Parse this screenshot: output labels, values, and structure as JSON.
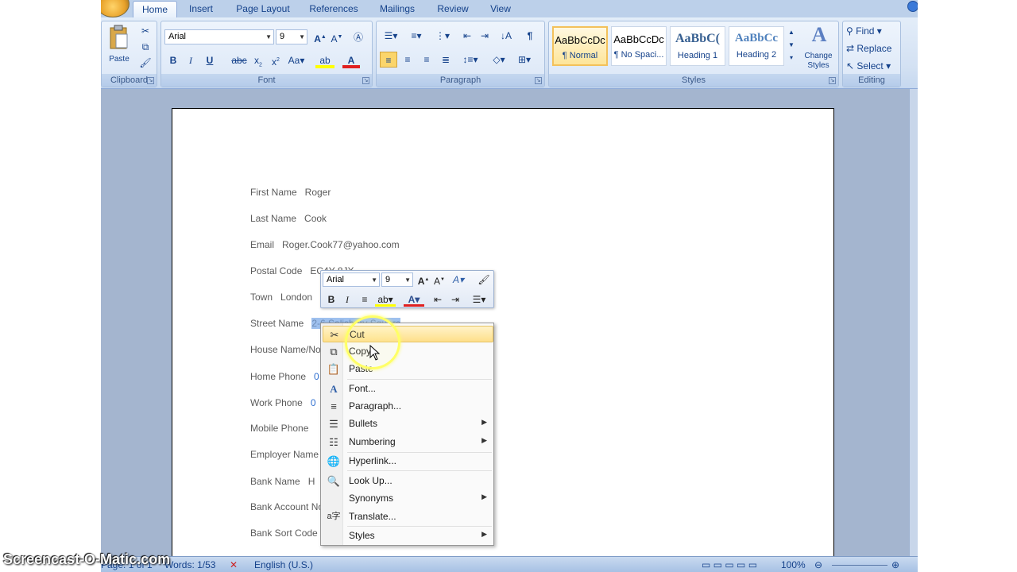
{
  "ribbon": {
    "tabs": [
      "Home",
      "Insert",
      "Page Layout",
      "References",
      "Mailings",
      "Review",
      "View"
    ],
    "clipboard": {
      "paste_label": "Paste",
      "group_label": "Clipboard"
    },
    "font": {
      "family": "Arial",
      "size": "9",
      "group_label": "Font"
    },
    "paragraph": {
      "group_label": "Paragraph"
    },
    "styles": {
      "group_label": "Styles",
      "items": [
        {
          "sample": "AaBbCcDc",
          "name": "¶ Normal"
        },
        {
          "sample": "AaBbCcDc",
          "name": "¶ No Spaci..."
        },
        {
          "sample": "AaBbC(",
          "name": "Heading 1"
        },
        {
          "sample": "AaBbCc",
          "name": "Heading 2"
        }
      ],
      "change_label": "Change\nStyles"
    },
    "editing": {
      "find": "Find",
      "replace": "Replace",
      "select": "Select",
      "group_label": "Editing"
    }
  },
  "document": {
    "fields": [
      {
        "label": "First Name",
        "value": "Roger"
      },
      {
        "label": "Last Name",
        "value": "Cook"
      },
      {
        "label": "Email",
        "value": "Roger.Cook77@yahoo.com"
      },
      {
        "label": "Postal Code",
        "value": "EC4Y 8JX"
      },
      {
        "label": "Town",
        "value": "London"
      },
      {
        "label": "Street Name",
        "value": "2-6 Salisbury Square"
      },
      {
        "label": "House Name/No",
        "value": ""
      },
      {
        "label": "Home Phone",
        "value": "0"
      },
      {
        "label": "Work Phone",
        "value": "0"
      },
      {
        "label": "Mobile Phone",
        "value": ""
      },
      {
        "label": "Employer Name",
        "value": ""
      },
      {
        "label": "Bank Name",
        "value": "H"
      },
      {
        "label": "Bank Account No",
        "value": ""
      },
      {
        "label": "Bank Sort Code",
        "value": ""
      }
    ]
  },
  "mini_toolbar": {
    "font": "Arial",
    "size": "9"
  },
  "context_menu": {
    "items": [
      {
        "label": "Cut",
        "icon": "scissors-icon",
        "highlighted": true
      },
      {
        "label": "Copy",
        "icon": "copy-icon"
      },
      {
        "label": "Paste",
        "icon": "paste-icon"
      },
      {
        "label": "Font...",
        "icon": "font-icon"
      },
      {
        "label": "Paragraph...",
        "icon": "paragraph-icon"
      },
      {
        "label": "Bullets",
        "icon": "bullets-icon",
        "submenu": true
      },
      {
        "label": "Numbering",
        "icon": "numbering-icon",
        "submenu": true
      },
      {
        "label": "Hyperlink...",
        "icon": "hyperlink-icon"
      },
      {
        "label": "Look Up...",
        "icon": "lookup-icon"
      },
      {
        "label": "Synonyms",
        "submenu": true
      },
      {
        "label": "Translate...",
        "icon": "translate-icon"
      },
      {
        "label": "Styles",
        "submenu": true
      }
    ]
  },
  "status_bar": {
    "page": "Page: 1 of 1",
    "words": "Words: 1/53",
    "language": "English (U.S.)",
    "zoom": "100%"
  },
  "watermark": "Screencast-O-Matic.com"
}
